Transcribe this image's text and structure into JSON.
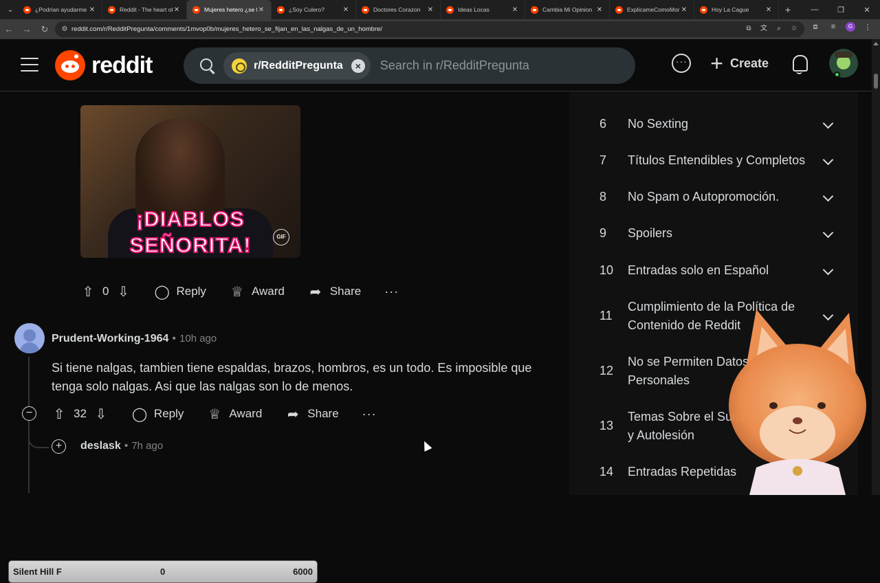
{
  "browser": {
    "tabs": [
      {
        "title": "¿Podrían ayudarme c",
        "active": false
      },
      {
        "title": "Reddit - The heart of",
        "active": false
      },
      {
        "title": "Mujeres hetero ¿se fij",
        "active": true
      },
      {
        "title": "¿Soy Culero?",
        "active": false
      },
      {
        "title": "Doctores Corazon",
        "active": false
      },
      {
        "title": "Ideas Locas",
        "active": false
      },
      {
        "title": "Cambia Mi Opinion",
        "active": false
      },
      {
        "title": "ExplicameComoMor",
        "active": false
      },
      {
        "title": "Hoy La Cague",
        "active": false
      }
    ],
    "url": "reddit.com/r/RedditPregunta/comments/1mvop0b/mujeres_hetero_se_fijan_en_las_nalgas_de_un_hombre/",
    "profile_initial": "G"
  },
  "header": {
    "logo_text": "reddit",
    "search_chip": "r/RedditPregunta",
    "search_placeholder": "Search in r/RedditPregunta",
    "create_label": "Create"
  },
  "gif_post": {
    "caption_line1": "¡DIABLOS",
    "caption_line2": "SEÑORITA!",
    "badge": "GIF",
    "votes": "0",
    "reply_label": "Reply",
    "award_label": "Award",
    "share_label": "Share"
  },
  "comment": {
    "author": "Prudent-Working-1964",
    "age": "10h ago",
    "body": "Si tiene nalgas, tambien tiene espaldas, brazos, hombros, es un todo. Es imposible que tenga solo nalgas. Asi que las nalgas son lo de menos.",
    "votes": "32",
    "reply_label": "Reply",
    "award_label": "Award",
    "share_label": "Share"
  },
  "reply": {
    "author": "deslask",
    "age": "7h ago"
  },
  "overlay": {
    "game": "Silent Hill F",
    "start": "0",
    "goal": "6000"
  },
  "rules": [
    {
      "num": "6",
      "text": "No Sexting"
    },
    {
      "num": "7",
      "text": "Títulos Entendibles y Completos"
    },
    {
      "num": "8",
      "text": "No Spam o Autopromoción."
    },
    {
      "num": "9",
      "text": "Spoilers"
    },
    {
      "num": "10",
      "text": "Entradas solo en Español"
    },
    {
      "num": "11",
      "text": "Cumplimiento de la Política de Contenido de Reddit"
    },
    {
      "num": "12",
      "text": "No se Permiten Datos Personales"
    },
    {
      "num": "13",
      "text": "Temas Sobre el Suicidio y Autolesión"
    },
    {
      "num": "14",
      "text": "Entradas Repetidas"
    }
  ],
  "colors": {
    "brand": "#ff4500",
    "background": "#0b0b0b",
    "sidebar": "#111112",
    "text": "#d7dadc",
    "muted": "#818384"
  }
}
